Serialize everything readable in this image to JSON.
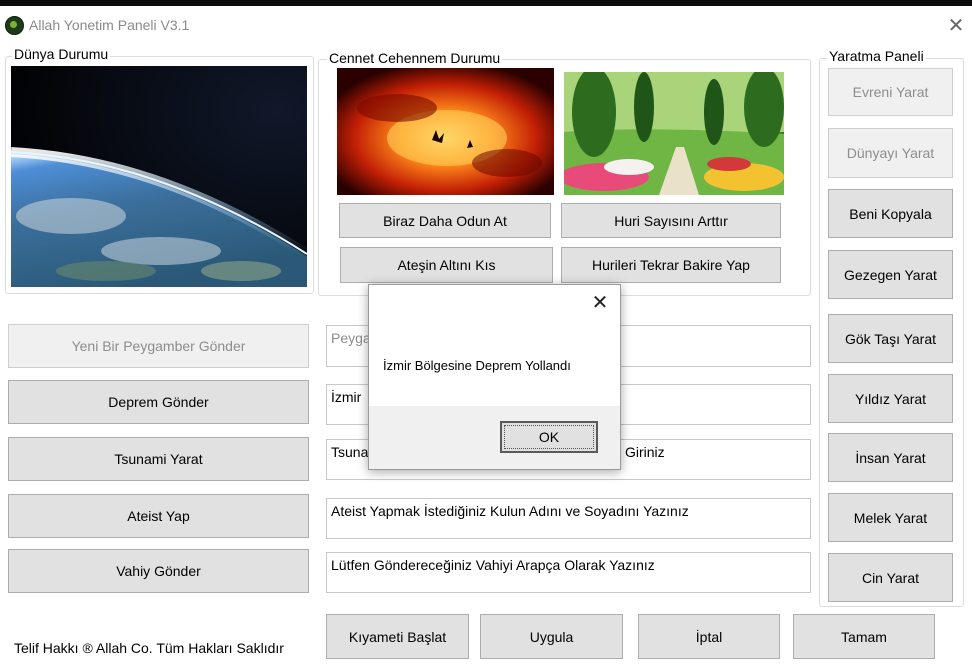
{
  "window": {
    "title": "Allah Yonetim Paneli V3.1",
    "close_glyph": "✕",
    "app_icon": "app-logo-icon"
  },
  "world_status": {
    "legend": "Dünya Durumu"
  },
  "heaven_hell": {
    "legend": "Cennet Cehennem Durumu",
    "buttons": {
      "more_wood": "Biraz Daha Odun At",
      "more_houris": "Huri Sayısını Arttır",
      "lower_fire": "Ateşin Altını Kıs",
      "virgin_again": "Hurileri Tekrar Bakire Yap"
    }
  },
  "creation_panel": {
    "legend": "Yaratma Paneli",
    "buttons": [
      "Evreni Yarat",
      "Dünyayı Yarat",
      "Beni Kopyala",
      "Gezegen Yarat",
      "Gök Taşı Yarat",
      "Yıldız Yarat",
      "İnsan Yarat",
      "Melek Yarat",
      "Cin Yarat"
    ]
  },
  "actions": {
    "prophet": "Yeni Bir Peygamber Gönder",
    "earthquake": "Deprem Gönder",
    "tsunami": "Tsunami Yarat",
    "atheist": "Ateist Yap",
    "revelation": "Vahiy Gönder"
  },
  "fields": {
    "prophet": "Peyga",
    "earthquake": "İzmir",
    "tsunami_left": "Tsuna",
    "tsunami_right": "Giriniz",
    "atheist": "Ateist Yapmak İstediğiniz Kulun Adını ve Soyadını Yazınız",
    "revelation": "Lütfen Göndereceğiniz Vahiyi Arapça Olarak Yazınız"
  },
  "bottom": {
    "copyright": "Telif Hakkı ® Allah Co. Tüm Hakları Saklıdır",
    "doomsday": "Kıyameti Başlat",
    "apply": "Uygula",
    "cancel": "İptal",
    "ok": "Tamam"
  },
  "dialog": {
    "close_glyph": "✕",
    "message": "İzmir Bölgesine Deprem Yollandı",
    "ok": "OK"
  },
  "colors": {
    "button_bg": "#e1e1e1",
    "disabled_text": "#8d8d8d",
    "border": "#adadad"
  }
}
